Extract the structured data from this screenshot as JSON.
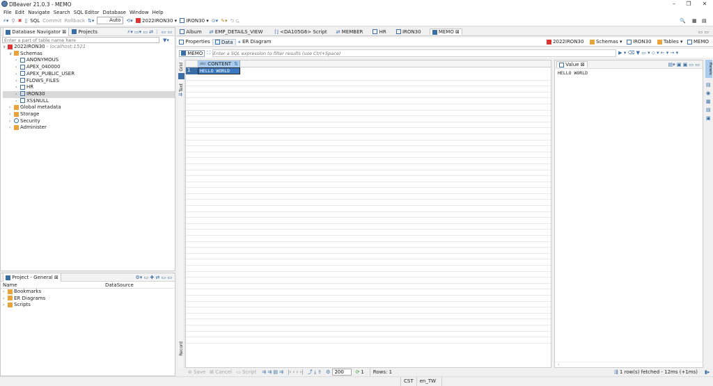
{
  "window": {
    "title": "DBeaver 21.0.3 - MEMO"
  },
  "menu": [
    "File",
    "Edit",
    "Navigate",
    "Search",
    "SQL Editor",
    "Database",
    "Window",
    "Help"
  ],
  "toolbar": {
    "sql": "SQL",
    "commit": "Commit",
    "rollback": "Rollback",
    "auto": "Auto",
    "connection": "2022IRON30",
    "schema": "IRON30"
  },
  "navigator": {
    "tab_db": "Database Navigator",
    "tab_projects": "Projects",
    "filter_placeholder": "Enter a part of table name here",
    "connection": "2022IRON30",
    "connection_host": "- localhost:1521",
    "schemas_label": "Schemas",
    "schemas": [
      "ANONYMOUS",
      "APEX_040000",
      "APEX_PUBLIC_USER",
      "FLOWS_FILES",
      "HR",
      "IRON30",
      "XS$NULL"
    ],
    "others": [
      "Global metadata",
      "Storage",
      "Security",
      "Administer"
    ]
  },
  "project": {
    "title": "Project - General",
    "col_name": "Name",
    "col_ds": "DataSource",
    "items": [
      "Bookmarks",
      "ER Diagrams",
      "Scripts"
    ]
  },
  "editor_tabs": [
    "Album",
    "EMP_DETAILS_VIEW",
    "<DA105G6> Script",
    "MEMBER",
    "HR",
    "IRON30",
    "MEMO"
  ],
  "sub_tabs": [
    "Properties",
    "Data",
    "ER Diagram"
  ],
  "breadcrumb": {
    "conn": "2022IRON30",
    "schemas": "Schemas",
    "schema": "IRON30",
    "tables": "Tables",
    "table": "MEMO"
  },
  "filter": {
    "table": "MEMO",
    "placeholder": "Enter a SQL expression to filter results (use Ctrl+Space)"
  },
  "grid": {
    "column": "CONTENT",
    "rows": [
      {
        "num": "1",
        "content": "HELLO WORLD"
      }
    ],
    "side_grid": "Grid",
    "side_text": "Text",
    "side_record": "Record"
  },
  "value_panel": {
    "title": "Value",
    "text": "HELLO WORLD"
  },
  "right_strip": {
    "panels": "Panels"
  },
  "status": {
    "save": "Save",
    "cancel": "Cancel",
    "script": "Script",
    "fetch_size": "200",
    "refresh_count": "1",
    "rows": "Rows: 1",
    "fetched": "1 row(s) fetched - 12ms (+1ms)"
  },
  "bottom": {
    "tz": "CST",
    "locale": "en_TW"
  }
}
